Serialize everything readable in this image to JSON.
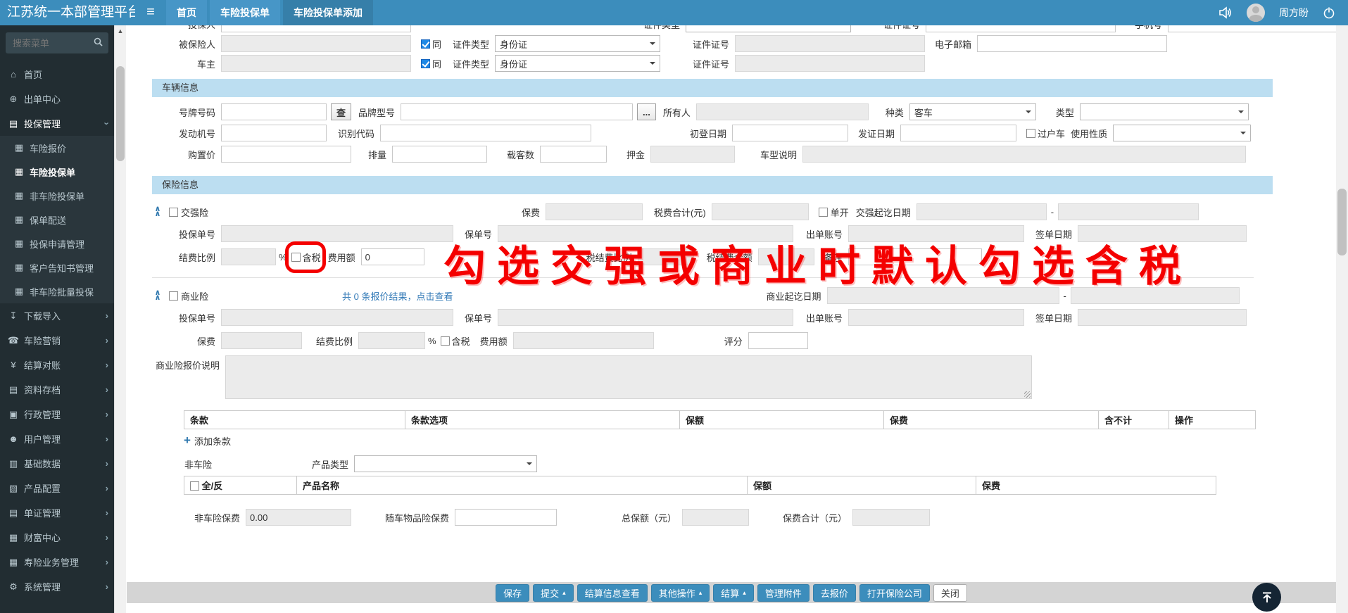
{
  "navbar": {
    "title": "江苏统一本部管理平台",
    "tabs": [
      "首页",
      "车险投保单",
      "车险投保单添加"
    ],
    "user_name": "周方盼"
  },
  "sidebar": {
    "search_placeholder": "搜索菜单",
    "home": "首页",
    "issue_center": "出单中心",
    "policy_mgmt": "投保管理",
    "sub": [
      "车险报价",
      "车险投保单",
      "非车险投保单",
      "保单配送",
      "投保申请管理",
      "客户告知书管理",
      "非车险批量投保"
    ],
    "groups": [
      "下载导入",
      "车险营销",
      "结算对账",
      "资料存档",
      "行政管理",
      "用户管理",
      "基础数据",
      "产品配置",
      "单证管理",
      "财富中心",
      "寿险业务管理",
      "系统管理"
    ]
  },
  "form": {
    "applicant_row": {
      "label": "投保人",
      "cert_type_label": "证件类型",
      "cert_no_label": "证件证号",
      "phone_label": "手机号"
    },
    "insured_row": {
      "label": "被保险人",
      "same_label": "同",
      "cert_type_label": "证件类型",
      "cert_type_value": "身份证",
      "cert_no_label": "证件证号",
      "email_label": "电子邮箱"
    },
    "owner_row": {
      "label": "车主",
      "same_label": "同",
      "cert_type_label": "证件类型",
      "cert_type_value": "身份证",
      "cert_no_label": "证件证号"
    },
    "vehicle": {
      "section_title": "车辆信息",
      "plate_label": "号牌号码",
      "check_btn": "查",
      "brand_label": "品牌型号",
      "more_btn": "...",
      "owner_label": "所有人",
      "kind_label": "种类",
      "kind_value": "客车",
      "type_label": "类型",
      "engine_label": "发动机号",
      "vin_label": "识别代码",
      "first_reg_label": "初登日期",
      "issue_label": "发证日期",
      "transfer_label": "过户车",
      "usage_label": "使用性质",
      "price_label": "购置价",
      "displacement_label": "排量",
      "seats_label": "载客数",
      "deposit_label": "押金",
      "model_desc_label": "车型说明"
    },
    "insurance": {
      "section_title": "保险信息",
      "jq": {
        "name": "交强险",
        "premium_label": "保费",
        "tax_total_label": "税费合计(元)",
        "single_label": "单开",
        "period_label": "交强起讫日期",
        "dash": "-",
        "policy_app_no_label": "投保单号",
        "policy_no_label": "保单号",
        "account_label": "出单账号",
        "sign_date_label": "签单日期",
        "settle_ratio_label": "结费比例",
        "percent": "%",
        "tax_included_label": "含税",
        "fee_label": "费用额",
        "fee_value": "0",
        "tax_ratio_label": "税结费比例",
        "tax_fee_label": "税结费金额",
        "remark_label": "备注"
      },
      "sy": {
        "name": "商业险",
        "quote_link": "共 0 条报价结果，点击查看",
        "period_label": "商业起讫日期",
        "dash": "-",
        "policy_app_no_label": "投保单号",
        "policy_no_label": "保单号",
        "account_label": "出单账号",
        "sign_date_label": "签单日期",
        "premium_label": "保费",
        "settle_ratio_label": "结费比例",
        "percent": "%",
        "tax_included_label": "含税",
        "fee_label": "费用额",
        "score_label": "评分",
        "quote_desc_label": "商业险报价说明"
      }
    },
    "clause_table": {
      "headers": [
        "条款",
        "条款选项",
        "保额",
        "保费",
        "含不计",
        "操作"
      ],
      "add_label": "添加条款"
    },
    "nonauto": {
      "label": "非车险",
      "product_type_label": "产品类型",
      "headers": [
        "全/反",
        "产品名称",
        "保额",
        "保费"
      ]
    },
    "totals": {
      "nonauto_premium_label": "非车险保费",
      "nonauto_premium_value": "0.00",
      "cargo_label": "随车物品险保费",
      "total_insured_label": "总保额（元）",
      "premium_total_label": "保费合计（元）"
    }
  },
  "overlay": {
    "note": "勾选交强或商业时默认勾选含税"
  },
  "footer": {
    "buttons": [
      "保存",
      "提交",
      "结算信息查看",
      "其他操作",
      "结算",
      "管理附件",
      "去报价",
      "打开保险公司",
      "关闭"
    ]
  }
}
